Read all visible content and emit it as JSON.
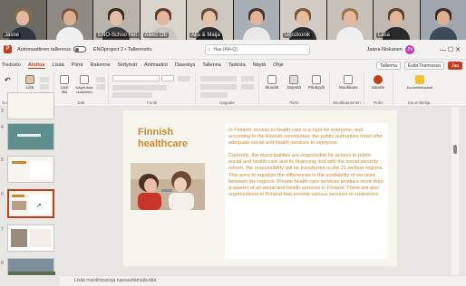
{
  "video": {
    "tiles": [
      {
        "name": "Jasne",
        "bg": "#6d6a63",
        "skin": "#e2b9a0",
        "hair": "#8b6a44",
        "shirt": "#2f3640"
      },
      {
        "name": "",
        "bg": "#8f8a84",
        "skin": "#dcae94",
        "hair": "#7a5a3c",
        "shirt": "#f0f0f0"
      },
      {
        "name": "ENO-Schoo Het Assoc...",
        "bg": "#b9b3ab",
        "skin": "#e4bfa7",
        "hair": "#3d2b22",
        "shirt": "#3b3b3b"
      },
      {
        "name": "Aleks Ob",
        "bg": "#d9d4cc",
        "skin": "#e2b79c",
        "hair": "#5a3e2c",
        "shirt": "#c9c5c0"
      },
      {
        "name": "Alja & Maija",
        "bg": "#cfc8bf",
        "skin": "#e7c2a9",
        "hair": "#6b4a35",
        "shirt": "#2b2b2b"
      },
      {
        "name": "",
        "bg": "#a9b0b5",
        "skin": "#e0b59a",
        "hair": "#4a3528",
        "shirt": "#e9e9e9"
      },
      {
        "name": "Ugozkonik",
        "bg": "#d2ccc5",
        "skin": "#e5bda3",
        "hair": "#7c5638",
        "shirt": "#2f2f2f"
      },
      {
        "name": "",
        "bg": "#c7c1b8",
        "skin": "#e3b99f",
        "hair": "#9a7448",
        "shirt": "#efefef"
      },
      {
        "name": "Lasa",
        "bg": "#bfb9b2",
        "skin": "#e2b69b",
        "hair": "#5d402d",
        "shirt": "#2a2a2a"
      },
      {
        "name": "",
        "bg": "#9fa6ad",
        "skin": "#dcb093",
        "hair": "#3f2c21",
        "shirt": "#3d4a5a"
      }
    ]
  },
  "titlebar": {
    "autosave": "Automaattinen tallennus",
    "document": "ENOproject 2 • Tallennettu",
    "search": "Hae (Alt+Q)",
    "user": "Jaana Niskanen",
    "initials": "JN",
    "window_controls": "—   ☐   ✕"
  },
  "ribbon": {
    "tabs": [
      "Tiedosto",
      "Aloitus",
      "Lisää",
      "Piirrä",
      "Rakenne",
      "Siirtymät",
      "Animaatiot",
      "Diaesitys",
      "Tallenna",
      "Tarkista",
      "Näytä",
      "Ohje"
    ],
    "active_tab": "Aloitus",
    "record_label": "Tallenna",
    "teams_label": "Esitä Teamsissa",
    "share_label": "Jaa",
    "groups": {
      "undo": "Kumoa",
      "clipboard": "Leikepöytä",
      "slides": "Diat",
      "font": "Fontti",
      "paragraph": "Kappale",
      "drawing": "Piirto",
      "editing": "Muokkaaminen",
      "voice": "Puhe",
      "designer": "Suunnittelija"
    },
    "buttons": {
      "paste": "Liitä",
      "new_slide": "Uusi dia",
      "reuse": "Käytä diaa uudelleen",
      "shapes": "Muodot",
      "arrange": "Järjestä",
      "quick_styles": "Pikatyylit",
      "editing": "Muokkaus",
      "dictate": "Sanele",
      "designer": "Suunnitteluideat"
    }
  },
  "slidepanel": {
    "numbers": [
      "3",
      "4",
      "5",
      "6",
      "7",
      "8"
    ],
    "selected": "6"
  },
  "slide": {
    "title": "Finnish healthcare",
    "paragraphs": [
      "In Finland, access to health care is a right for everyone, and according to the Finnish constitution, the public authorities must offer adequate social and health services to everyone.",
      "Currently, the municipalities are responsible for access to public social and health care and its financing, but with the social security reform, the responsibility will be transferred to the 21 welfare regions. This aims to equalize the differences in the availability of services between the regions. Private health care services produce more than a quarter of all social and health services in Finland. There are also organizations in Finland that provide various services to customers."
    ]
  },
  "notes": {
    "placeholder": "Lisää muistiinpanoja napsauttamalla tätä"
  },
  "colors": {
    "accent": "#c43e1c",
    "slide_text": "#c98a2b"
  }
}
